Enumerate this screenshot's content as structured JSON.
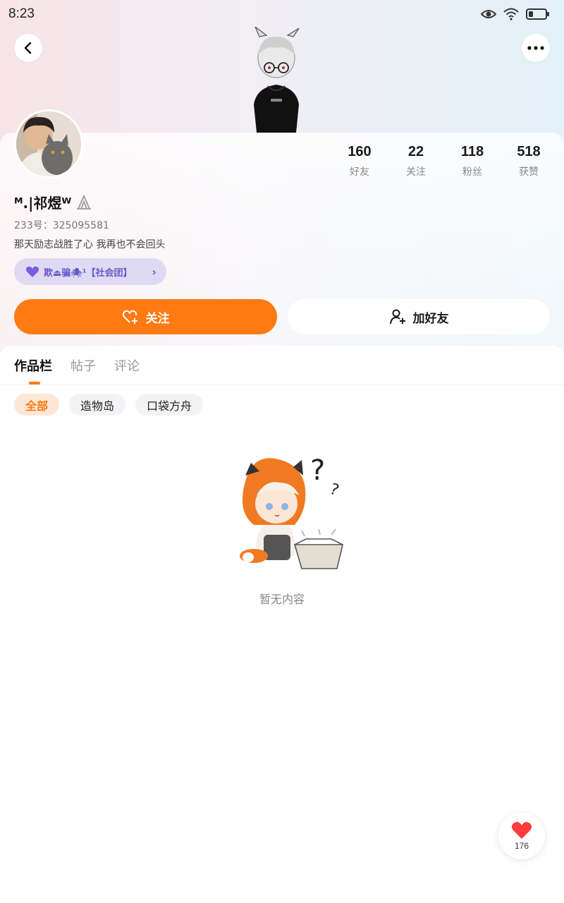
{
  "status_bar": {
    "time": "8:23"
  },
  "profile": {
    "stats": [
      {
        "value": "160",
        "label": "好友"
      },
      {
        "value": "22",
        "label": "关注"
      },
      {
        "value": "118",
        "label": "粉丝"
      },
      {
        "value": "518",
        "label": "获赞"
      }
    ],
    "username": "ᴹ.|祁煜ᵂ",
    "uid_label": "233号：325095581",
    "bio": "那天励志战胜了心 我再也不会回头",
    "club_tag": "欺⏏骗🕷¹【社会团】",
    "follow_label": "关注",
    "add_friend_label": "加好友"
  },
  "tabs": [
    {
      "label": "作品栏",
      "active": true
    },
    {
      "label": "帖子",
      "active": false
    },
    {
      "label": "评论",
      "active": false
    }
  ],
  "filters": [
    {
      "label": "全部",
      "active": true
    },
    {
      "label": "造物岛",
      "active": false
    },
    {
      "label": "口袋方舟",
      "active": false
    }
  ],
  "empty_state": {
    "text": "暂无内容"
  },
  "like_float": {
    "count": "176"
  },
  "colors": {
    "accent": "#ff7a12",
    "club": "#6a58c8"
  }
}
